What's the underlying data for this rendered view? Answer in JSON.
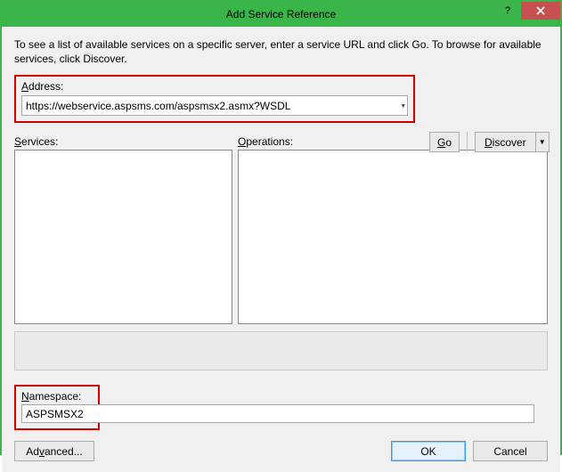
{
  "window": {
    "title": "Add Service Reference"
  },
  "instructions": "To see a list of available services on a specific server, enter a service URL and click Go. To browse for available services, click Discover.",
  "address": {
    "label_prefix": "A",
    "label_rest": "ddress:",
    "value": "https://webservice.aspsms.com/aspsmsx2.asmx?WSDL"
  },
  "buttons": {
    "go_prefix": "G",
    "go_rest": "o",
    "discover_prefix": "D",
    "discover_rest": "iscover",
    "advanced_prefix": "Ad",
    "advanced_underlined": "v",
    "advanced_rest": "anced...",
    "ok": "OK",
    "cancel": "Cancel"
  },
  "panels": {
    "services_prefix": "S",
    "services_rest": "ervices:",
    "operations_prefix": "O",
    "operations_rest": "perations:"
  },
  "namespace": {
    "label_prefix": "N",
    "label_rest": "amespace:",
    "value": "ASPSMSX2"
  }
}
